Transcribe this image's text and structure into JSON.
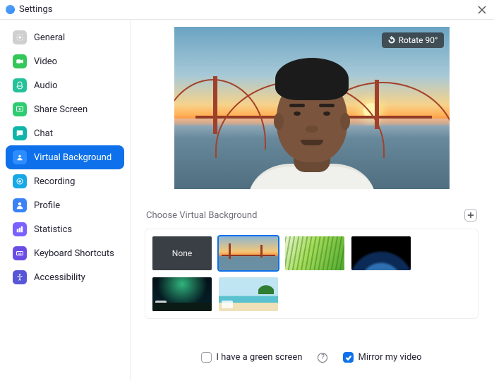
{
  "window": {
    "title": "Settings"
  },
  "sidebar": {
    "items": [
      {
        "label": "General",
        "icon": "gear-icon"
      },
      {
        "label": "Video",
        "icon": "video-icon"
      },
      {
        "label": "Audio",
        "icon": "audio-icon"
      },
      {
        "label": "Share Screen",
        "icon": "share-screen-icon"
      },
      {
        "label": "Chat",
        "icon": "chat-icon"
      },
      {
        "label": "Virtual Background",
        "icon": "virtual-background-icon"
      },
      {
        "label": "Recording",
        "icon": "recording-icon"
      },
      {
        "label": "Profile",
        "icon": "profile-icon"
      },
      {
        "label": "Statistics",
        "icon": "statistics-icon"
      },
      {
        "label": "Keyboard Shortcuts",
        "icon": "keyboard-icon"
      },
      {
        "label": "Accessibility",
        "icon": "accessibility-icon"
      }
    ],
    "active_index": 5
  },
  "preview": {
    "rotate_label": "Rotate 90°"
  },
  "backgrounds": {
    "section_title": "Choose Virtual Background",
    "items": [
      {
        "kind": "none",
        "label": "None"
      },
      {
        "kind": "bridge",
        "label": "Golden Gate Bridge",
        "selected": true
      },
      {
        "kind": "grass",
        "label": "Grass"
      },
      {
        "kind": "earth",
        "label": "Earth from space"
      },
      {
        "kind": "aurora",
        "label": "Aurora",
        "is_video": true
      },
      {
        "kind": "beach",
        "label": "Beach",
        "is_video": true
      }
    ]
  },
  "options": {
    "green_screen": {
      "label": "I have a green screen",
      "checked": false
    },
    "mirror": {
      "label": "Mirror my video",
      "checked": true
    }
  }
}
